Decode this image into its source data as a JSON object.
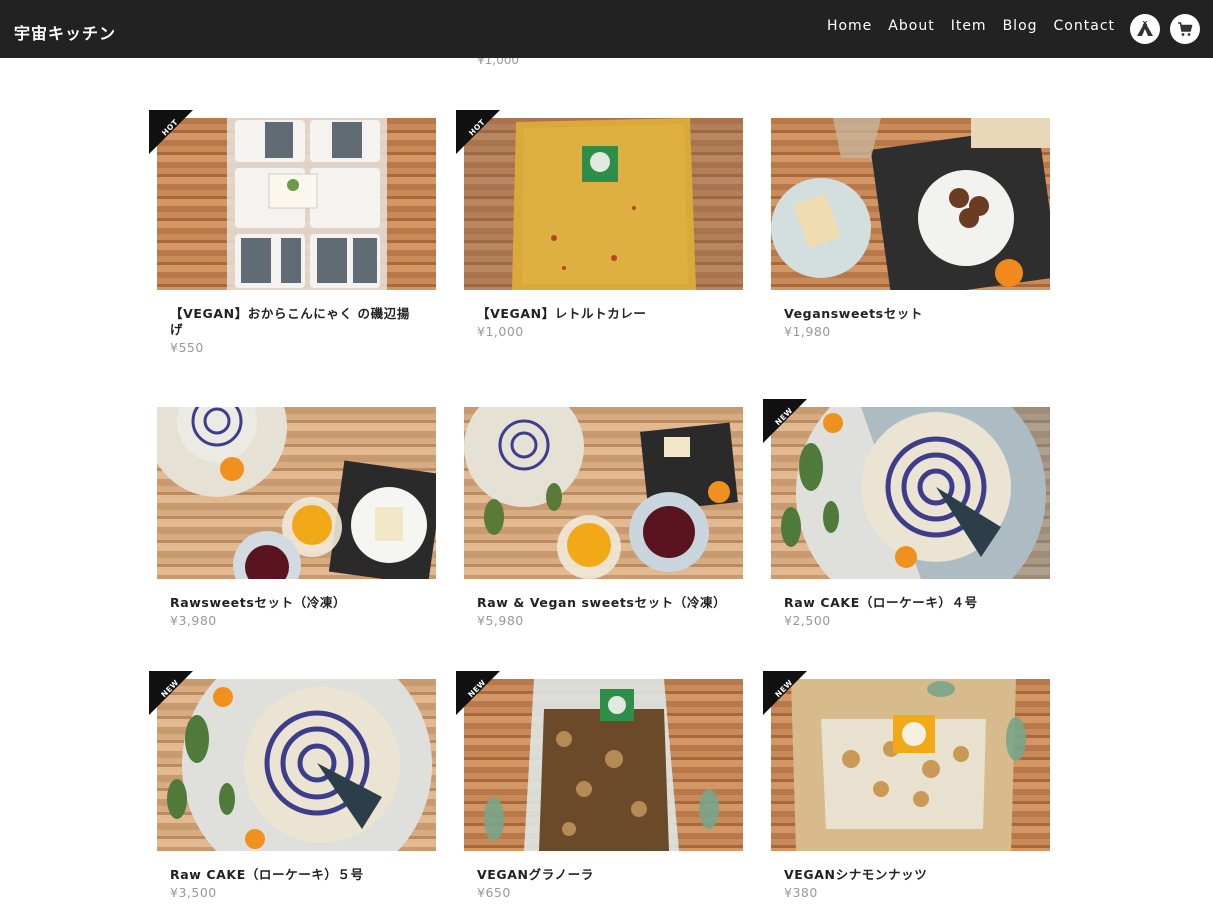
{
  "header": {
    "brand": "宇宙キッチン",
    "nav": [
      "Home",
      "About",
      "Item",
      "Blog",
      "Contact"
    ],
    "icons": [
      "teepee-icon",
      "cart-icon"
    ]
  },
  "peek": {
    "price": "¥1,000"
  },
  "products": [
    {
      "badge": "HOT",
      "title": "【VEGAN】おからこんにゃく の磯辺揚げ",
      "price": "¥550"
    },
    {
      "badge": "HOT",
      "title": "【VEGAN】レトルトカレー",
      "price": "¥1,000"
    },
    {
      "badge": "",
      "title": "Vegansweetsセット",
      "price": "¥1,980"
    },
    {
      "badge": "",
      "title": "Rawsweetsセット（冷凍）",
      "price": "¥3,980"
    },
    {
      "badge": "",
      "title": "Raw & Vegan sweetsセット（冷凍）",
      "price": "¥5,980"
    },
    {
      "badge": "NEW",
      "title": "Raw CAKE（ローケーキ）４号",
      "price": "¥2,500"
    },
    {
      "badge": "NEW",
      "title": "Raw CAKE（ローケーキ）５号",
      "price": "¥3,500"
    },
    {
      "badge": "NEW",
      "title": "VEGANグラノーラ",
      "price": "¥650"
    },
    {
      "badge": "NEW",
      "title": "VEGANシナモンナッツ",
      "price": "¥380"
    }
  ],
  "colors": {
    "header_bg": "#222222",
    "price": "#999999",
    "title": "#222222",
    "ribbon": "#111111"
  }
}
